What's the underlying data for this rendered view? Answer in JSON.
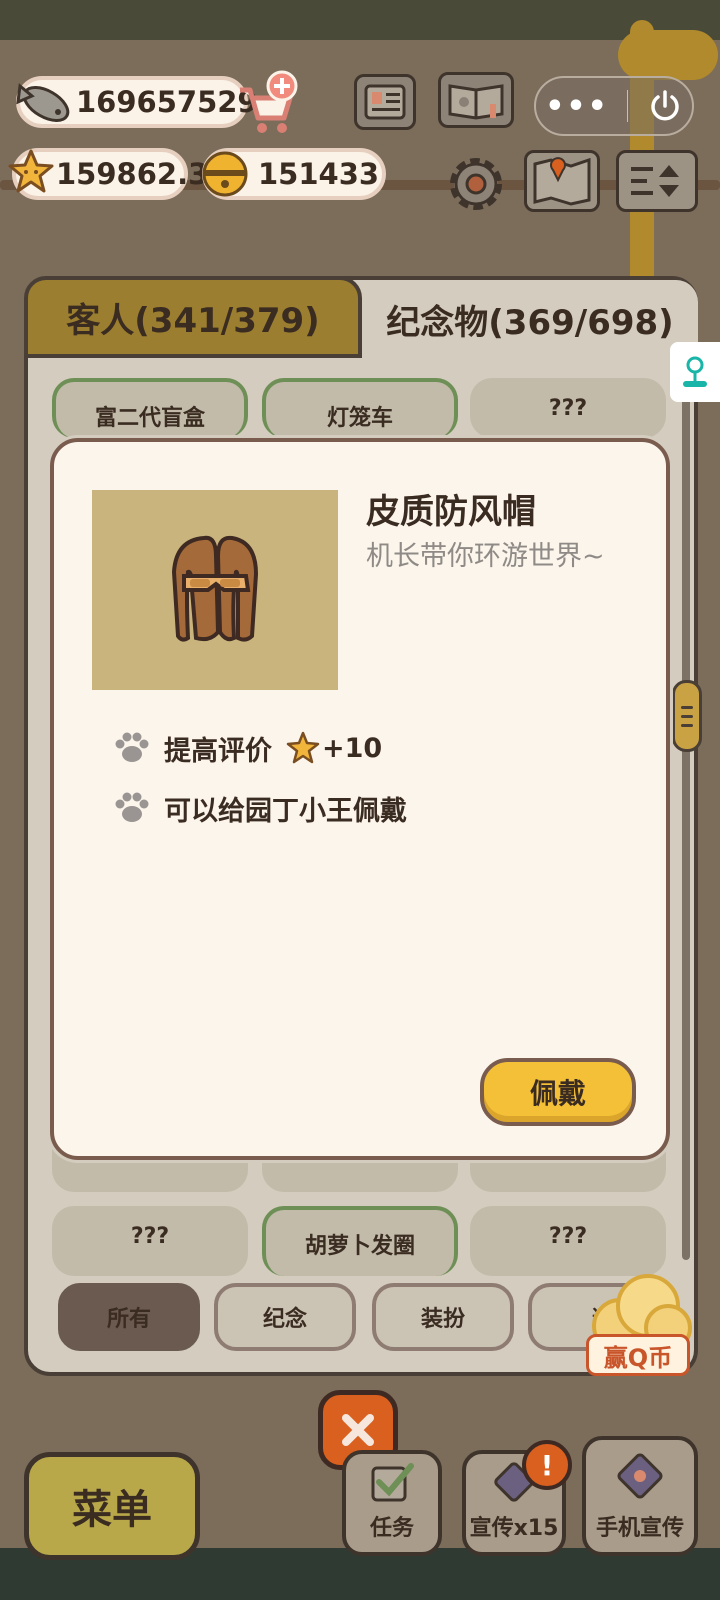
{
  "resources": {
    "fish": "169657529",
    "stars": "159862.3",
    "bells": "151433"
  },
  "tabs": {
    "guests": "客人(341/379)",
    "souvenirs": "纪念物(369/698)"
  },
  "grid": {
    "row1": [
      "富二代盲盒",
      "灯笼车",
      "???"
    ],
    "row3": [
      "???",
      "胡萝卜发圈",
      "???"
    ]
  },
  "dialog": {
    "item_name": "皮质防风帽",
    "item_desc": "机长带你环游世界~",
    "effect_rating_label": "提高评价",
    "effect_rating_value": "+10",
    "effect_wear": "可以给园丁小王佩戴",
    "wear_button": "佩戴"
  },
  "filters": [
    "所有",
    "纪念",
    "装扮",
    "道"
  ],
  "bottom": {
    "menu": "菜单",
    "tasks": "任务",
    "promo": "宣传x15",
    "phone_promo": "手机宣传",
    "badge": "!"
  },
  "ad": {
    "label": "赢Q币"
  },
  "colors": {
    "accent_yellow": "#f4c038",
    "close_orange": "#d9601f",
    "tab_active": "#9b7e2f"
  },
  "icons": [
    "fish-icon",
    "cart-plus-icon",
    "star-icon",
    "bell-icon",
    "notebook-icon",
    "book-icon",
    "gear-icon",
    "map-icon",
    "sort-icon",
    "power-icon",
    "more-icon",
    "paw-icon",
    "close-icon"
  ]
}
